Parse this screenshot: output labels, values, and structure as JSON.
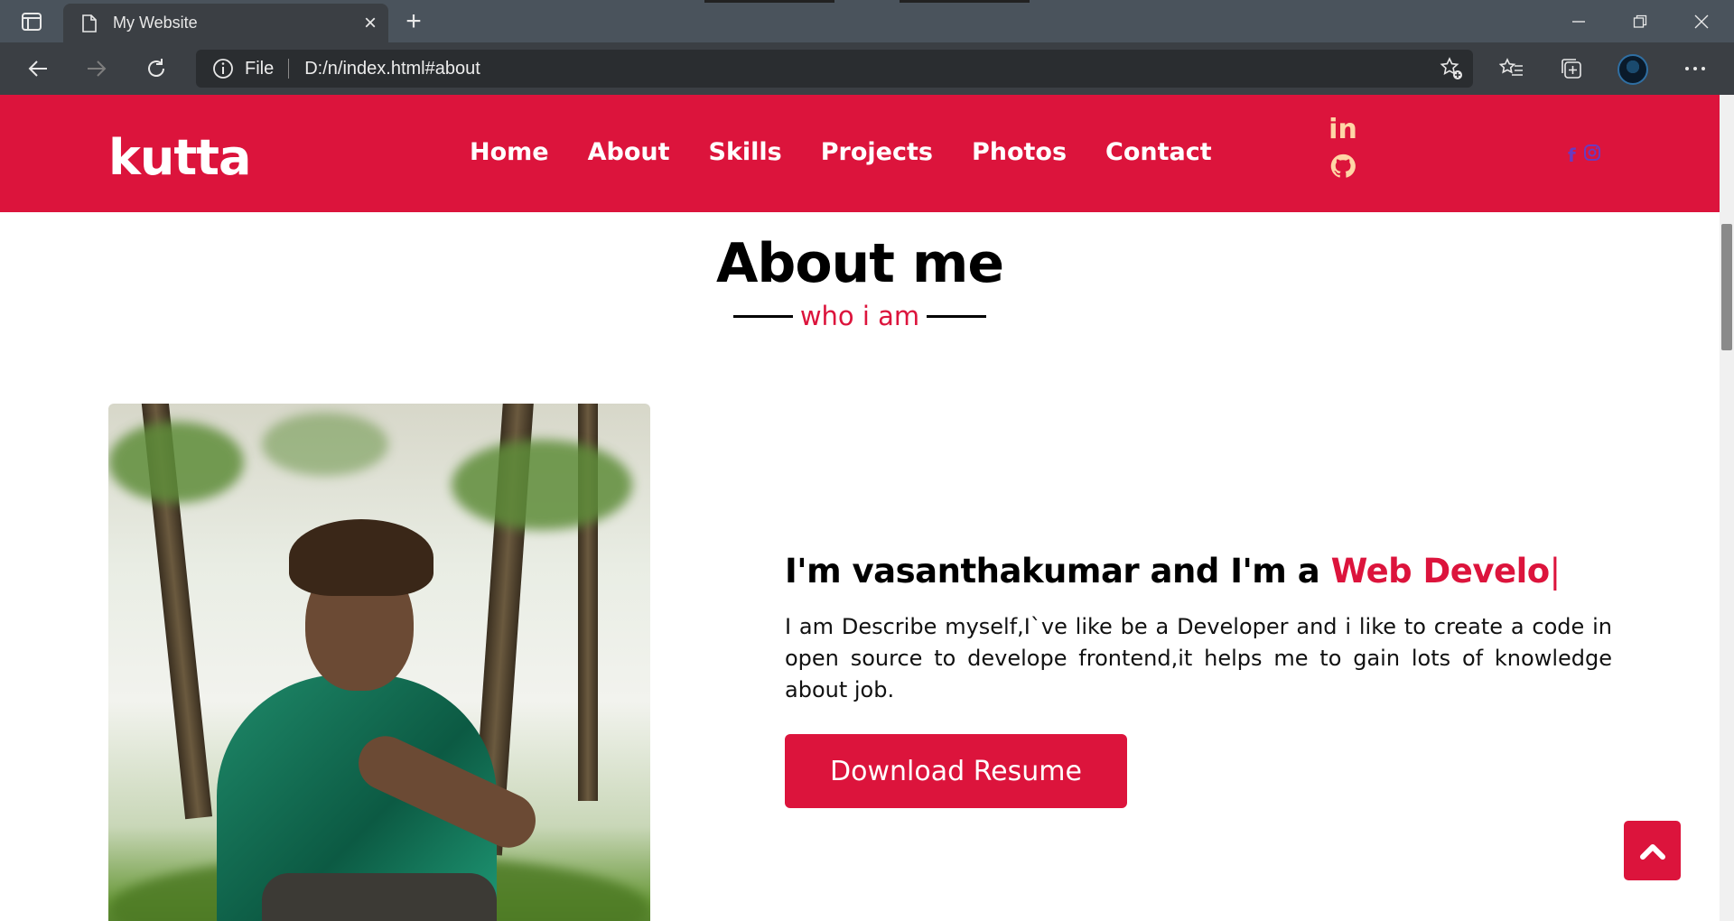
{
  "browser": {
    "tab_title": "My Website",
    "tab_close": "×",
    "new_tab": "+",
    "address_scheme": "File",
    "address_url": "D:/n/index.html#about"
  },
  "site": {
    "brand": "kutta",
    "menu": [
      "Home",
      "About",
      "Skills",
      "Projects",
      "Photos",
      "Contact"
    ],
    "social_stack": {
      "linkedin": "in"
    },
    "social_right": {
      "facebook": "f"
    }
  },
  "about": {
    "title": "About me",
    "subtitle": "who i am",
    "intro_prefix": "I'm vasanthakumar and I'm a ",
    "intro_role": "Web Develo",
    "intro_caret": "|",
    "description": "I am Describe myself,I`ve like be a Developer and i like to create a code in open source to develope frontend,it helps me to gain lots of knowledge about job.",
    "download_label": "Download Resume"
  },
  "colors": {
    "accent": "#dc143c",
    "chrome_dark": "#3b3f44",
    "chrome_tabbar": "#4a535c"
  }
}
